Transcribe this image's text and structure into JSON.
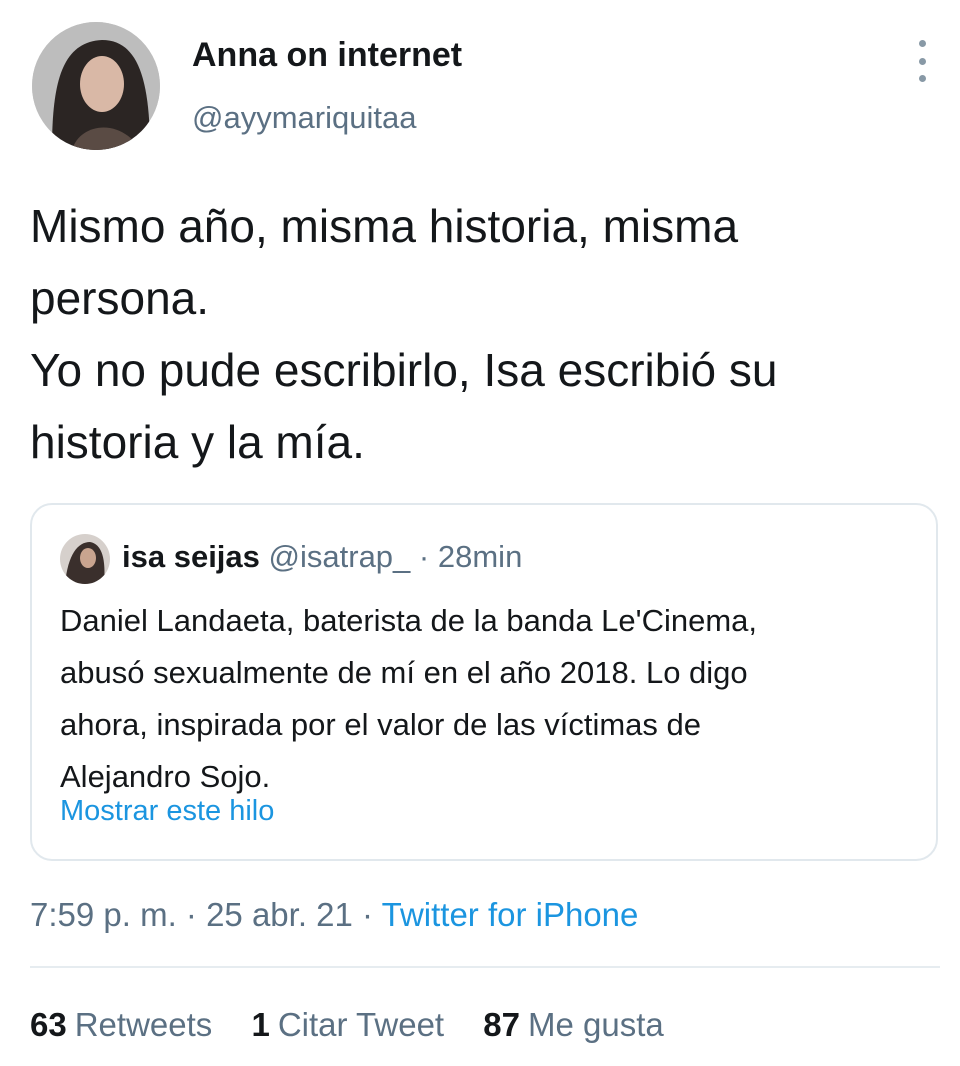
{
  "tweet": {
    "author": {
      "name": "Anna on internet",
      "handle": "@ayymariquitaa"
    },
    "text": "Mismo año, misma historia, misma\npersona.\nYo no pude escribirlo, Isa escribió su\nhistoria y la mía.",
    "quoted": {
      "name": "isa seijas",
      "handle": "@isatrap_",
      "separator": "·",
      "time": "28min",
      "text": "Daniel Landaeta, baterista de la banda Le'Cinema,\nabusó sexualmente de mí en el año 2018. Lo digo\nahora, inspirada por el valor de las víctimas de\nAlejandro Sojo.",
      "show_thread": "Mostrar este hilo"
    },
    "timestamp": {
      "time": "7:59 p. m.",
      "separator1": " · ",
      "date": "25 abr. 21",
      "separator2": " · ",
      "source": "Twitter for iPhone"
    },
    "stats": {
      "retweets": {
        "count": "63",
        "label": "Retweets"
      },
      "quotes": {
        "count": "1",
        "label": "Citar Tweet"
      },
      "likes": {
        "count": "87",
        "label": "Me gusta"
      }
    }
  },
  "icons": {
    "more": "more-vertical-icon"
  },
  "colors": {
    "link": "#1b95e0",
    "secondary_text": "#5b7083",
    "border": "#e1e8ed"
  }
}
